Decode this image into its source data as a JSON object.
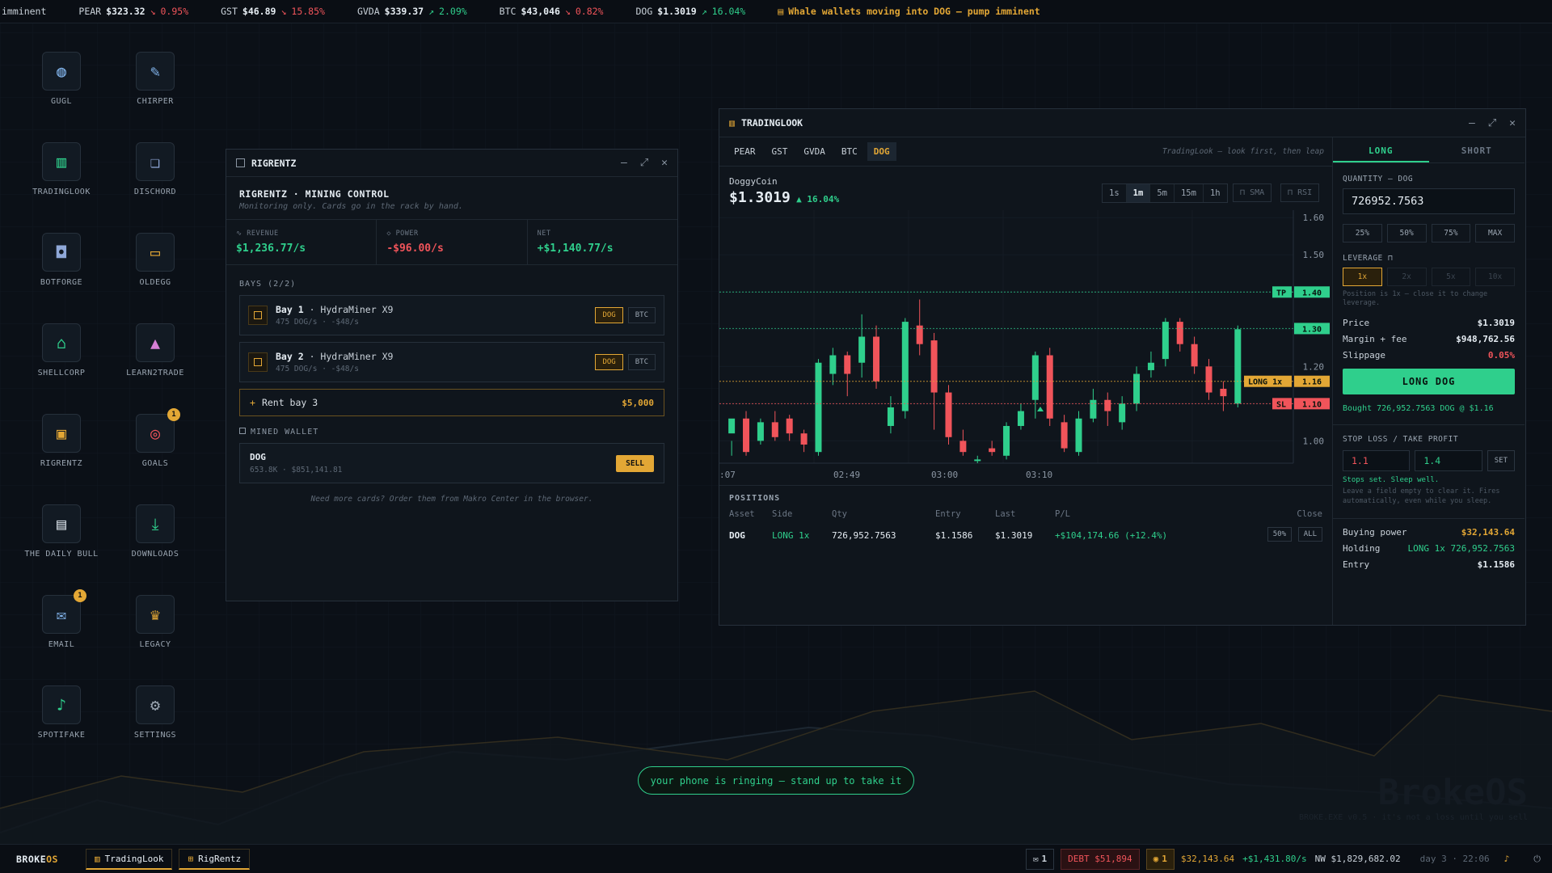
{
  "ticker": [
    {
      "sym": "",
      "price": "imminent",
      "arrow": "",
      "chg": "",
      "dir": ""
    },
    {
      "sym": "PEAR",
      "price": "$323.32",
      "arrow": "↘",
      "chg": "0.95%",
      "dir": "dn"
    },
    {
      "sym": "GST",
      "price": "$46.89",
      "arrow": "↘",
      "chg": "15.85%",
      "dir": "dn"
    },
    {
      "sym": "GVDA",
      "price": "$339.37",
      "arrow": "↗",
      "chg": "2.09%",
      "dir": "up"
    },
    {
      "sym": "BTC",
      "price": "$43,046",
      "arrow": "↘",
      "chg": "0.82%",
      "dir": "dn"
    },
    {
      "sym": "DOG",
      "price": "$1.3019",
      "arrow": "↗",
      "chg": "16.04%",
      "dir": "up"
    }
  ],
  "news": "Whale wallets moving into DOG — pump imminent",
  "desktop": [
    {
      "label": "GUGL",
      "icon": "globe-icon",
      "color": "#7fb0e6"
    },
    {
      "label": "CHIRPER",
      "icon": "bird-icon",
      "color": "#7fb0e6"
    },
    {
      "label": "TRADINGLOOK",
      "icon": "candlestick-icon",
      "color": "#2fcf8c"
    },
    {
      "label": "DISCHORD",
      "icon": "chat-icon",
      "color": "#8fa8d8"
    },
    {
      "label": "BOTFORGE",
      "icon": "robot-icon",
      "color": "#8fa8d8"
    },
    {
      "label": "OLDEGG",
      "icon": "inbox-icon",
      "color": "#e3a735"
    },
    {
      "label": "SHELLCORP",
      "icon": "bank-icon",
      "color": "#2fcf8c"
    },
    {
      "label": "LEARN2TRADE",
      "icon": "graduation-cap-icon",
      "color": "#d67fd6"
    },
    {
      "label": "RIGRENTZ",
      "icon": "chip-icon",
      "color": "#e3a735"
    },
    {
      "label": "GOALS",
      "icon": "target-icon",
      "color": "#f0545a",
      "badge": "1"
    },
    {
      "label": "THE DAILY BULL",
      "icon": "newspaper-icon",
      "color": "#c9d1d9"
    },
    {
      "label": "DOWNLOADS",
      "icon": "download-icon",
      "color": "#2fcf8c"
    },
    {
      "label": "EMAIL",
      "icon": "mail-icon",
      "color": "#7fb0e6",
      "badge": "1"
    },
    {
      "label": "LEGACY",
      "icon": "crown-icon",
      "color": "#e3a735"
    },
    {
      "label": "SPOTIFAKE",
      "icon": "music-icon",
      "color": "#2fcf8c"
    },
    {
      "label": "SETTINGS",
      "icon": "gear-icon",
      "color": "#9aa5b1"
    }
  ],
  "rig": {
    "title": "RIGRENTZ",
    "heading": "RIGRENTZ · MINING CONTROL",
    "sub": "Monitoring only. Cards go in the rack by hand.",
    "stats": [
      {
        "k": "∿ REVENUE",
        "v": "$1,236.77/s",
        "c": "#2fcf8c"
      },
      {
        "k": "◇ POWER",
        "v": "-$96.00/s",
        "c": "#f0545a"
      },
      {
        "k": "NET",
        "v": "+$1,140.77/s",
        "c": "#2fcf8c"
      }
    ],
    "bays_label": "BAYS (2/2)",
    "bays": [
      {
        "name": "Bay 1",
        "model": "· HydraMiner X9",
        "sub": "475 DOG/s · -$48/s",
        "c1": "DOG",
        "c2": "BTC"
      },
      {
        "name": "Bay 2",
        "model": "· HydraMiner X9",
        "sub": "475 DOG/s · -$48/s",
        "c1": "DOG",
        "c2": "BTC"
      }
    ],
    "rent": "Rent bay 3",
    "rent_price": "$5,000",
    "wallet_label": "MINED WALLET",
    "wallet": {
      "coin": "DOG",
      "sub": "653.8K · $851,141.81",
      "sell": "SELL"
    },
    "note": "Need more cards? Order them from Makro Center in the browser."
  },
  "trade": {
    "title": "TRADINGLOOK",
    "tabs": [
      "PEAR",
      "GST",
      "GVDA",
      "BTC",
      "DOG"
    ],
    "tagline": "TradingLook — look first, then leap",
    "coin": "DoggyCoin",
    "price": "$1.3019",
    "chg": "▲ 16.04%",
    "tfs": [
      "1s",
      "1m",
      "5m",
      "15m",
      "1h"
    ],
    "sma": "SMA",
    "rsi": "RSI",
    "pos_label": "POSITIONS",
    "pos_cols": [
      "Asset",
      "Side",
      "Qty",
      "Entry",
      "Last",
      "P/L",
      "Close"
    ],
    "pos": {
      "asset": "DOG",
      "side": "LONG 1x",
      "qty": "726,952.7563",
      "entry": "$1.1586",
      "last": "$1.3019",
      "pl": "+$104,174.66 (+12.4%)",
      "b1": "50%",
      "b2": "ALL"
    },
    "long": "LONG",
    "short": "SHORT",
    "qty_label": "QUANTITY — DOG",
    "qty": "726952.7563",
    "pcts": [
      "25%",
      "50%",
      "75%",
      "MAX"
    ],
    "lev_label": "LEVERAGE",
    "levs": [
      "1x",
      "2x",
      "5x",
      "10x"
    ],
    "lev_note": "Position is 1x — close it to change leverage.",
    "price_k": "Price",
    "price_v": "$1.3019",
    "margin_k": "Margin + fee",
    "margin_v": "$948,762.56",
    "slip_k": "Slippage",
    "slip_v": "0.05%",
    "btn": "LONG DOG",
    "bought": "Bought 726,952.7563 DOG @ $1.16",
    "sltp_label": "STOP LOSS / TAKE PROFIT",
    "sl": "1.1",
    "tp": "1.4",
    "set": "SET",
    "sltp_ok": "Stops set. Sleep well.",
    "sltp_note": "Leave a field empty to clear it. Fires automatically, even while you sleep.",
    "bp_k": "Buying power",
    "bp_v": "$32,143.64",
    "hold_k": "Holding",
    "hold_v": "LONG 1x 726,952.7563",
    "entry_k": "Entry",
    "entry_v": "$1.1586"
  },
  "chart_data": {
    "type": "candlestick",
    "x_ticks": [
      ":07",
      "02:49",
      "03:00",
      "03:10"
    ],
    "y_ticks": [
      1.0,
      1.1,
      1.2,
      1.3,
      1.4,
      1.5,
      1.6
    ],
    "ylim": [
      0.94,
      1.62
    ],
    "levels": [
      {
        "label": "TP",
        "value": "1.40",
        "v": 1.4,
        "color": "#2fcf8c"
      },
      {
        "label": "LONG 1x",
        "value": "1.16",
        "v": 1.16,
        "color": "#e3a735"
      },
      {
        "label": "SL",
        "value": "1.10",
        "v": 1.1,
        "color": "#f0545a"
      }
    ],
    "last": "1.30",
    "last_v": 1.3019,
    "candles": [
      [
        1.02,
        1.06,
        1.0,
        0.96
      ],
      [
        1.06,
        0.97,
        1.08,
        0.96
      ],
      [
        1.0,
        1.05,
        1.06,
        0.99
      ],
      [
        1.05,
        1.01,
        1.08,
        1.0
      ],
      [
        1.06,
        1.02,
        1.07,
        1.0
      ],
      [
        1.02,
        0.99,
        1.03,
        0.97
      ],
      [
        0.97,
        1.21,
        1.22,
        0.96
      ],
      [
        1.18,
        1.23,
        1.25,
        1.15
      ],
      [
        1.23,
        1.18,
        1.24,
        1.12
      ],
      [
        1.21,
        1.28,
        1.34,
        1.17
      ],
      [
        1.28,
        1.16,
        1.31,
        1.14
      ],
      [
        1.04,
        1.09,
        1.12,
        1.02
      ],
      [
        1.08,
        1.32,
        1.33,
        1.06
      ],
      [
        1.31,
        1.26,
        1.38,
        1.23
      ],
      [
        1.27,
        1.13,
        1.29,
        1.03
      ],
      [
        1.13,
        1.01,
        1.15,
        0.99
      ],
      [
        1.0,
        0.97,
        1.03,
        0.96
      ],
      [
        0.95,
        0.95,
        0.96,
        0.94
      ],
      [
        0.98,
        0.97,
        1.0,
        0.96
      ],
      [
        0.96,
        1.04,
        1.05,
        0.95
      ],
      [
        1.04,
        1.08,
        1.1,
        1.03
      ],
      [
        1.11,
        1.23,
        1.24,
        1.06
      ],
      [
        1.23,
        1.06,
        1.25,
        1.04
      ],
      [
        1.05,
        0.98,
        1.07,
        0.97
      ],
      [
        0.97,
        1.06,
        1.08,
        0.96
      ],
      [
        1.06,
        1.11,
        1.14,
        1.05
      ],
      [
        1.11,
        1.08,
        1.13,
        1.04
      ],
      [
        1.05,
        1.1,
        1.12,
        1.03
      ],
      [
        1.1,
        1.18,
        1.2,
        1.08
      ],
      [
        1.19,
        1.21,
        1.24,
        1.17
      ],
      [
        1.22,
        1.32,
        1.33,
        1.2
      ],
      [
        1.32,
        1.26,
        1.33,
        1.24
      ],
      [
        1.26,
        1.2,
        1.28,
        1.18
      ],
      [
        1.2,
        1.13,
        1.22,
        1.11
      ],
      [
        1.14,
        1.12,
        1.16,
        1.08
      ],
      [
        1.1,
        1.3,
        1.31,
        1.09
      ]
    ]
  },
  "toast": "your phone is ringing — stand up to take it",
  "brand": {
    "big": "BrokeOS",
    "sub": "BROKE.EXE v0.5 · it's not a loss until you sell"
  },
  "taskbar": {
    "logo1": "BROKE",
    "logo2": "OS",
    "apps": [
      "TradingLook",
      "RigRentz"
    ],
    "mail": "1",
    "debt": "DEBT $51,894",
    "coin": "1",
    "cash": "$32,143.64",
    "rate": "+$1,431.80/s",
    "nw": "NW $1,829,682.02",
    "day": "day 3 · 22:06"
  },
  "colors": {
    "accent": "#e3a735",
    "up": "#2fcf8c",
    "down": "#f0545a"
  }
}
